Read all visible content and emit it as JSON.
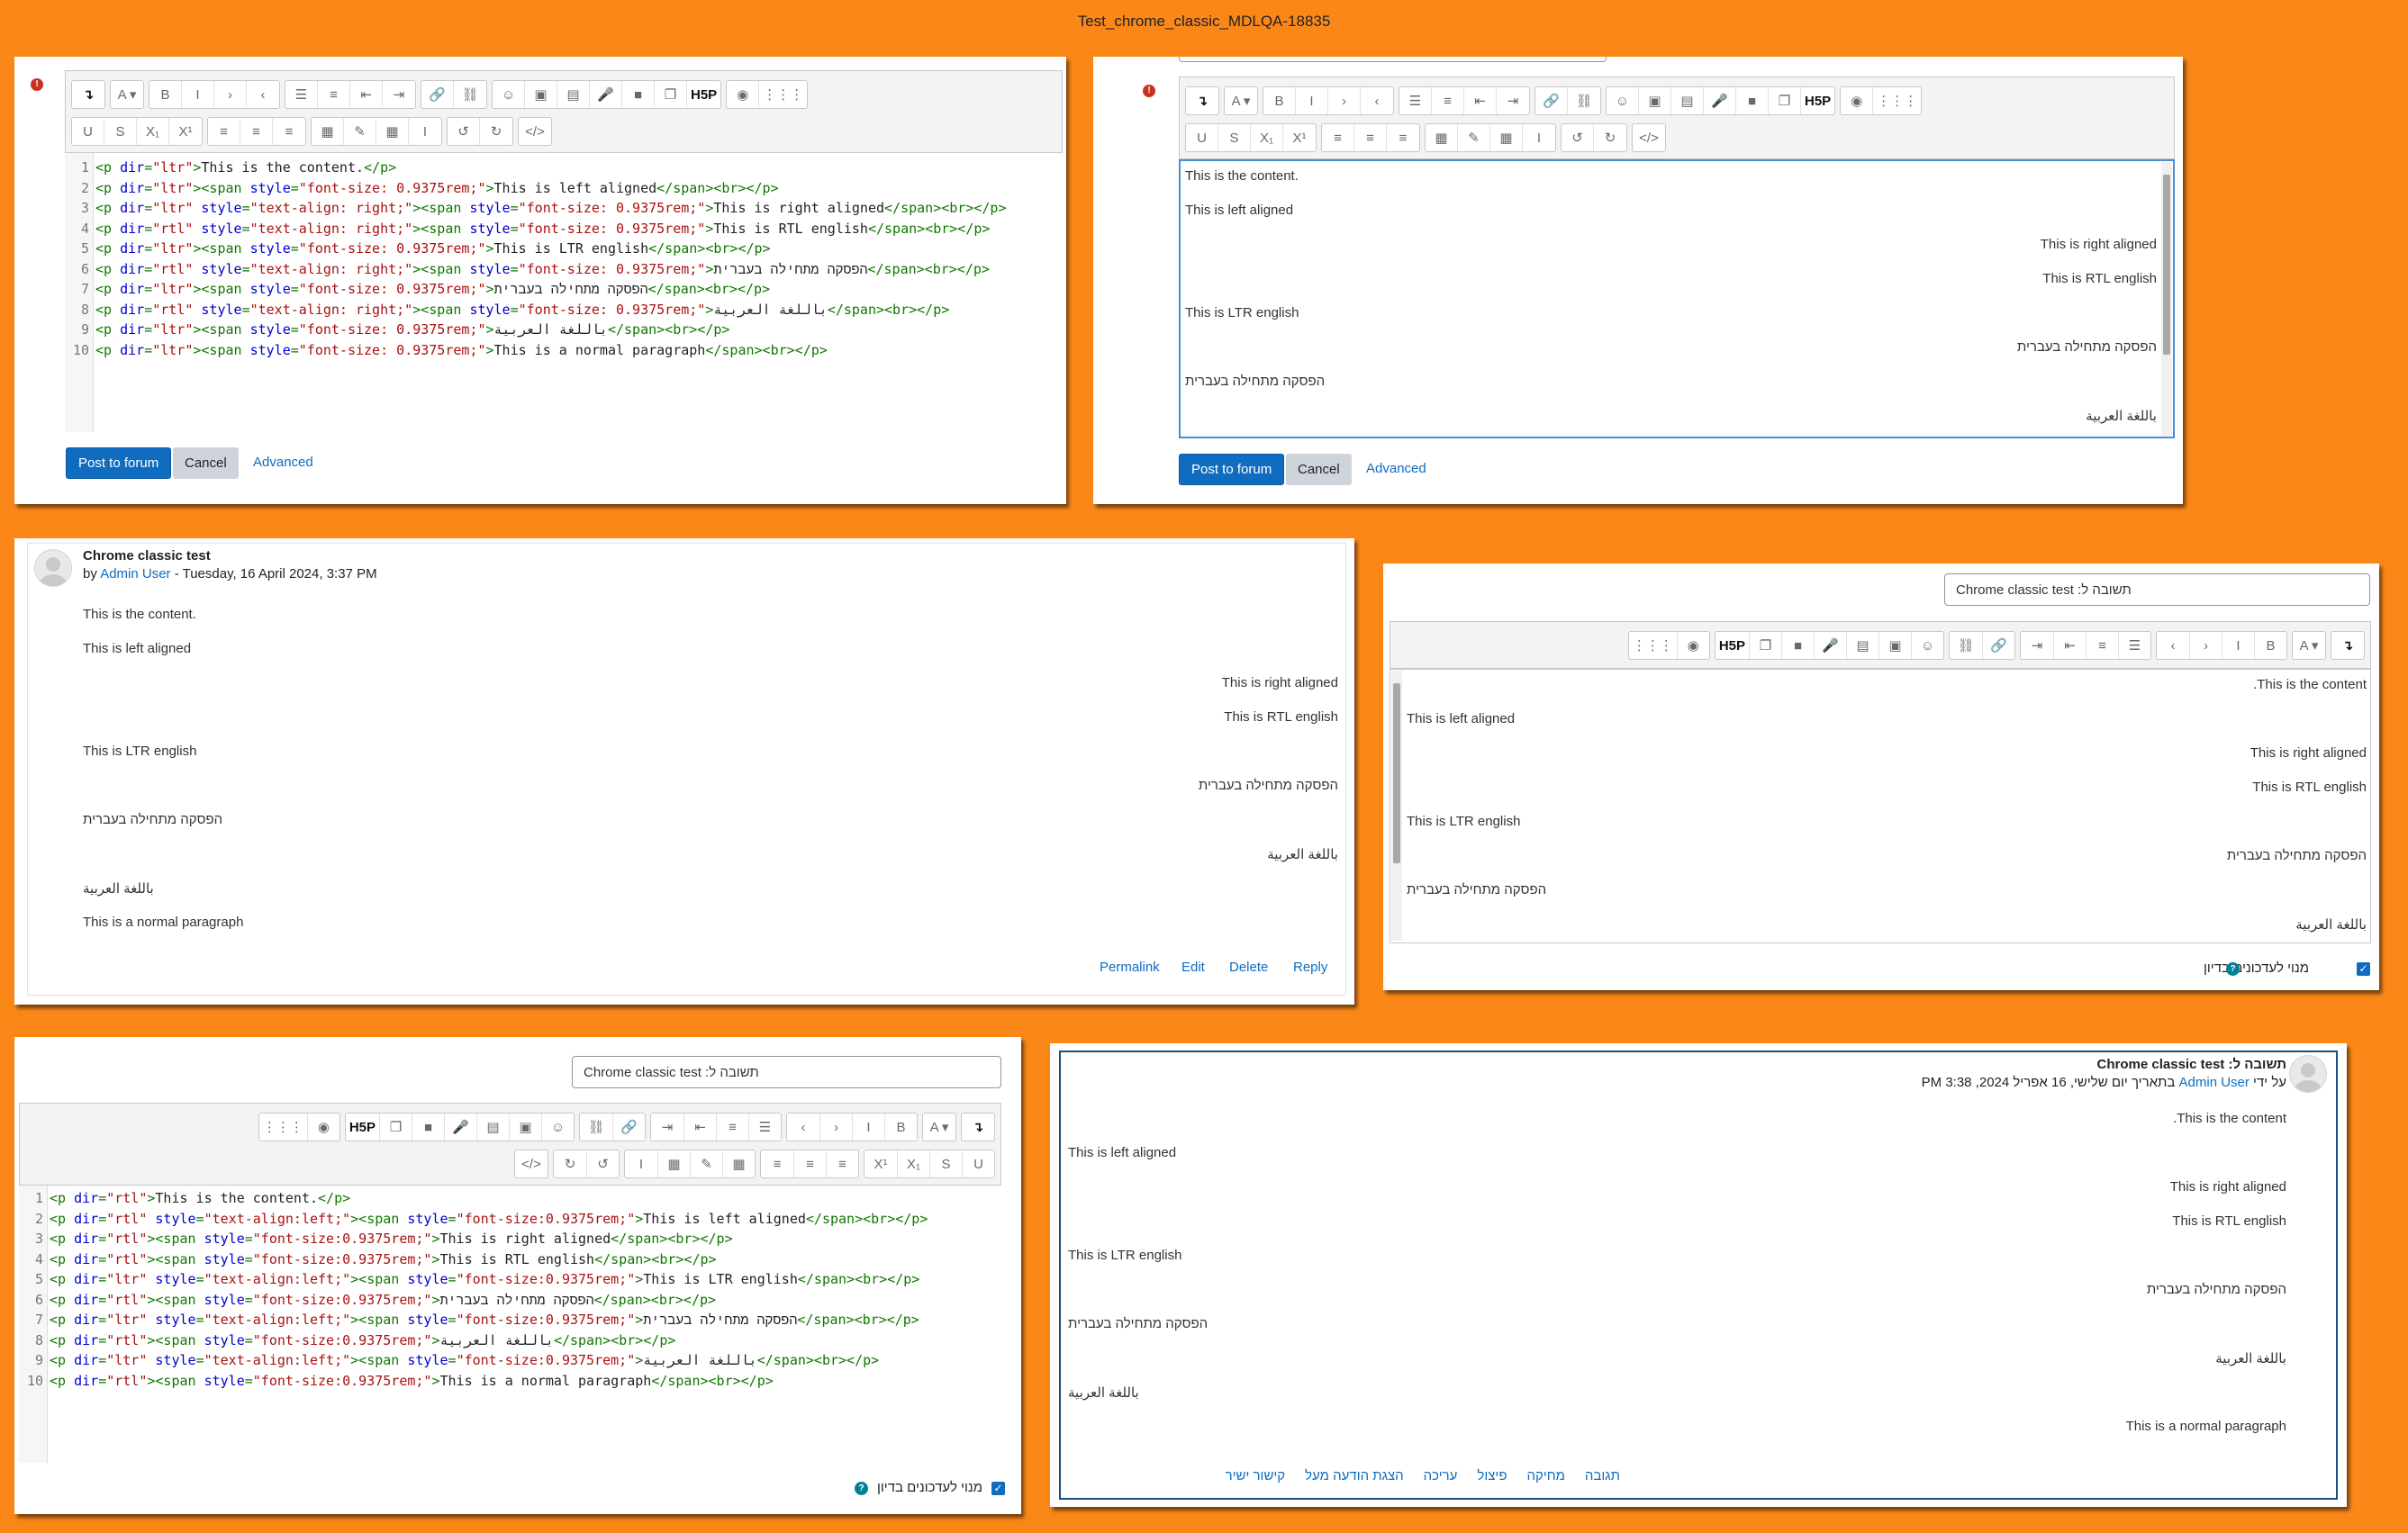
{
  "window_title": "Test_chrome_classic_MDLQA-18835",
  "code_lines": [
    [
      [
        "t",
        "<p "
      ],
      [
        "a",
        "dir"
      ],
      [
        "t",
        "="
      ],
      [
        "s",
        "\"ltr\""
      ],
      [
        "t",
        ">"
      ],
      [
        "x",
        "This is the content."
      ],
      [
        "t",
        "</p>"
      ]
    ],
    [
      [
        "t",
        "<p "
      ],
      [
        "a",
        "dir"
      ],
      [
        "t",
        "="
      ],
      [
        "s",
        "\"ltr\""
      ],
      [
        "t",
        "><span "
      ],
      [
        "a",
        "style"
      ],
      [
        "t",
        "="
      ],
      [
        "s",
        "\"font-size: 0.9375rem;\""
      ],
      [
        "t",
        ">"
      ],
      [
        "x",
        "This is left aligned"
      ],
      [
        "t",
        "</span><br></p>"
      ]
    ],
    [
      [
        "t",
        "<p "
      ],
      [
        "a",
        "dir"
      ],
      [
        "t",
        "="
      ],
      [
        "s",
        "\"ltr\" "
      ],
      [
        "a",
        "style"
      ],
      [
        "t",
        "="
      ],
      [
        "s",
        "\"text-align: right;\""
      ],
      [
        "t",
        "><span "
      ],
      [
        "a",
        "style"
      ],
      [
        "t",
        "="
      ],
      [
        "s",
        "\"font-size: 0.9375rem;\""
      ],
      [
        "t",
        ">"
      ],
      [
        "x",
        "This is right aligned"
      ],
      [
        "t",
        "</span><br></p>"
      ]
    ],
    [
      [
        "t",
        "<p "
      ],
      [
        "a",
        "dir"
      ],
      [
        "t",
        "="
      ],
      [
        "s",
        "\"rtl\" "
      ],
      [
        "a",
        "style"
      ],
      [
        "t",
        "="
      ],
      [
        "s",
        "\"text-align: right;\""
      ],
      [
        "t",
        "><span "
      ],
      [
        "a",
        "style"
      ],
      [
        "t",
        "="
      ],
      [
        "s",
        "\"font-size: 0.9375rem;\""
      ],
      [
        "t",
        ">"
      ],
      [
        "x",
        "This is RTL english"
      ],
      [
        "t",
        "</span><br></p>"
      ]
    ],
    [
      [
        "t",
        "<p "
      ],
      [
        "a",
        "dir"
      ],
      [
        "t",
        "="
      ],
      [
        "s",
        "\"ltr\""
      ],
      [
        "t",
        "><span "
      ],
      [
        "a",
        "style"
      ],
      [
        "t",
        "="
      ],
      [
        "s",
        "\"font-size: 0.9375rem;\""
      ],
      [
        "t",
        ">"
      ],
      [
        "x",
        "This is LTR english"
      ],
      [
        "t",
        "</span><br></p>"
      ]
    ],
    [
      [
        "t",
        "<p "
      ],
      [
        "a",
        "dir"
      ],
      [
        "t",
        "="
      ],
      [
        "s",
        "\"rtl\" "
      ],
      [
        "a",
        "style"
      ],
      [
        "t",
        "="
      ],
      [
        "s",
        "\"text-align: right;\""
      ],
      [
        "t",
        "><span "
      ],
      [
        "a",
        "style"
      ],
      [
        "t",
        "="
      ],
      [
        "s",
        "\"font-size: 0.9375rem;\""
      ],
      [
        "t",
        ">"
      ],
      [
        "x",
        "הפסקה מתחילה בעברית"
      ],
      [
        "t",
        "</span><br></p>"
      ]
    ],
    [
      [
        "t",
        "<p "
      ],
      [
        "a",
        "dir"
      ],
      [
        "t",
        "="
      ],
      [
        "s",
        "\"ltr\""
      ],
      [
        "t",
        "><span "
      ],
      [
        "a",
        "style"
      ],
      [
        "t",
        "="
      ],
      [
        "s",
        "\"font-size: 0.9375rem;\""
      ],
      [
        "t",
        ">"
      ],
      [
        "x",
        "הפסקה מתחילה בעברית"
      ],
      [
        "t",
        "</span><br></p>"
      ]
    ],
    [
      [
        "t",
        "<p "
      ],
      [
        "a",
        "dir"
      ],
      [
        "t",
        "="
      ],
      [
        "s",
        "\"rtl\" "
      ],
      [
        "a",
        "style"
      ],
      [
        "t",
        "="
      ],
      [
        "s",
        "\"text-align: right;\""
      ],
      [
        "t",
        "><span "
      ],
      [
        "a",
        "style"
      ],
      [
        "t",
        "="
      ],
      [
        "s",
        "\"font-size: 0.9375rem;\""
      ],
      [
        "t",
        ">"
      ],
      [
        "x",
        "باللغة العربية"
      ],
      [
        "t",
        "</span><br></p>"
      ]
    ],
    [
      [
        "t",
        "<p "
      ],
      [
        "a",
        "dir"
      ],
      [
        "t",
        "="
      ],
      [
        "s",
        "\"ltr\""
      ],
      [
        "t",
        "><span "
      ],
      [
        "a",
        "style"
      ],
      [
        "t",
        "="
      ],
      [
        "s",
        "\"font-size: 0.9375rem;\""
      ],
      [
        "t",
        ">"
      ],
      [
        "x",
        "باللغة العربية"
      ],
      [
        "t",
        "</span><br></p>"
      ]
    ],
    [
      [
        "t",
        "<p "
      ],
      [
        "a",
        "dir"
      ],
      [
        "t",
        "="
      ],
      [
        "s",
        "\"ltr\""
      ],
      [
        "t",
        "><span "
      ],
      [
        "a",
        "style"
      ],
      [
        "t",
        "="
      ],
      [
        "s",
        "\"font-size: 0.9375rem;\""
      ],
      [
        "t",
        ">"
      ],
      [
        "x",
        "This is a normal paragraph"
      ],
      [
        "t",
        "</span><br></p>"
      ]
    ]
  ],
  "code_lines_rtl": [
    [
      [
        "t",
        "<p "
      ],
      [
        "a",
        "dir"
      ],
      [
        "t",
        "="
      ],
      [
        "s",
        "\"rtl\""
      ],
      [
        "t",
        ">"
      ],
      [
        "x",
        "This is the content."
      ],
      [
        "t",
        "</p>"
      ]
    ],
    [
      [
        "t",
        "<p "
      ],
      [
        "a",
        "dir"
      ],
      [
        "t",
        "="
      ],
      [
        "s",
        "\"rtl\" "
      ],
      [
        "a",
        "style"
      ],
      [
        "t",
        "="
      ],
      [
        "s",
        "\"text-align:left;\""
      ],
      [
        "t",
        "><span "
      ],
      [
        "a",
        "style"
      ],
      [
        "t",
        "="
      ],
      [
        "s",
        "\"font-size:0.9375rem;\""
      ],
      [
        "t",
        ">"
      ],
      [
        "x",
        "This is left aligned"
      ],
      [
        "t",
        "</span><br></p>"
      ]
    ],
    [
      [
        "t",
        "<p "
      ],
      [
        "a",
        "dir"
      ],
      [
        "t",
        "="
      ],
      [
        "s",
        "\"rtl\""
      ],
      [
        "t",
        "><span "
      ],
      [
        "a",
        "style"
      ],
      [
        "t",
        "="
      ],
      [
        "s",
        "\"font-size:0.9375rem;\""
      ],
      [
        "t",
        ">"
      ],
      [
        "x",
        "This is right aligned"
      ],
      [
        "t",
        "</span><br></p>"
      ]
    ],
    [
      [
        "t",
        "<p "
      ],
      [
        "a",
        "dir"
      ],
      [
        "t",
        "="
      ],
      [
        "s",
        "\"rtl\""
      ],
      [
        "t",
        "><span "
      ],
      [
        "a",
        "style"
      ],
      [
        "t",
        "="
      ],
      [
        "s",
        "\"font-size:0.9375rem;\""
      ],
      [
        "t",
        ">"
      ],
      [
        "x",
        "This is RTL english"
      ],
      [
        "t",
        "</span><br></p>"
      ]
    ],
    [
      [
        "t",
        "<p "
      ],
      [
        "a",
        "dir"
      ],
      [
        "t",
        "="
      ],
      [
        "s",
        "\"ltr\" "
      ],
      [
        "a",
        "style"
      ],
      [
        "t",
        "="
      ],
      [
        "s",
        "\"text-align:left;\""
      ],
      [
        "t",
        "><span "
      ],
      [
        "a",
        "style"
      ],
      [
        "t",
        "="
      ],
      [
        "s",
        "\"font-size:0.9375rem;\""
      ],
      [
        "t",
        ">"
      ],
      [
        "x",
        "This is LTR english"
      ],
      [
        "t",
        "</span><br></p>"
      ]
    ],
    [
      [
        "t",
        "<p "
      ],
      [
        "a",
        "dir"
      ],
      [
        "t",
        "="
      ],
      [
        "s",
        "\"rtl\""
      ],
      [
        "t",
        "><span "
      ],
      [
        "a",
        "style"
      ],
      [
        "t",
        "="
      ],
      [
        "s",
        "\"font-size:0.9375rem;\""
      ],
      [
        "t",
        ">"
      ],
      [
        "x",
        "הפסקה מתחילה בעברית"
      ],
      [
        "t",
        "</span><br></p>"
      ]
    ],
    [
      [
        "t",
        "<p "
      ],
      [
        "a",
        "dir"
      ],
      [
        "t",
        "="
      ],
      [
        "s",
        "\"ltr\" "
      ],
      [
        "a",
        "style"
      ],
      [
        "t",
        "="
      ],
      [
        "s",
        "\"text-align:left;\""
      ],
      [
        "t",
        "><span "
      ],
      [
        "a",
        "style"
      ],
      [
        "t",
        "="
      ],
      [
        "s",
        "\"font-size:0.9375rem;\""
      ],
      [
        "t",
        ">"
      ],
      [
        "x",
        "הפסקה מתחילה בעברית"
      ],
      [
        "t",
        "</span><br></p>"
      ]
    ],
    [
      [
        "t",
        "<p "
      ],
      [
        "a",
        "dir"
      ],
      [
        "t",
        "="
      ],
      [
        "s",
        "\"rtl\""
      ],
      [
        "t",
        "><span "
      ],
      [
        "a",
        "style"
      ],
      [
        "t",
        "="
      ],
      [
        "s",
        "\"font-size:0.9375rem;\""
      ],
      [
        "t",
        ">"
      ],
      [
        "x",
        "باللغة العربية"
      ],
      [
        "t",
        "</span><br></p>"
      ]
    ],
    [
      [
        "t",
        "<p "
      ],
      [
        "a",
        "dir"
      ],
      [
        "t",
        "="
      ],
      [
        "s",
        "\"ltr\" "
      ],
      [
        "a",
        "style"
      ],
      [
        "t",
        "="
      ],
      [
        "s",
        "\"text-align:left;\""
      ],
      [
        "t",
        "><span "
      ],
      [
        "a",
        "style"
      ],
      [
        "t",
        "="
      ],
      [
        "s",
        "\"font-size:0.9375rem;\""
      ],
      [
        "t",
        ">"
      ],
      [
        "x",
        "باللغة العربية"
      ],
      [
        "t",
        "</span><br></p>"
      ]
    ],
    [
      [
        "t",
        "<p "
      ],
      [
        "a",
        "dir"
      ],
      [
        "t",
        "="
      ],
      [
        "s",
        "\"rtl\""
      ],
      [
        "t",
        "><span "
      ],
      [
        "a",
        "style"
      ],
      [
        "t",
        "="
      ],
      [
        "s",
        "\"font-size:0.9375rem;\""
      ],
      [
        "t",
        ">"
      ],
      [
        "x",
        "This is a normal paragraph"
      ],
      [
        "t",
        "</span><br></p>"
      ]
    ]
  ],
  "paragraphs": {
    "content": "This is the content.",
    "left": "This is left aligned",
    "right": "This is right aligned",
    "rtl_en": "This is RTL english",
    "ltr_en": "This is LTR english",
    "hebrew": "הפסקה מתחילה בעברית",
    "arabic": "باللغة العربية",
    "normal": "This is a normal paragraph",
    "content_rtl": ".This is the content"
  },
  "buttons": {
    "post": "Post to forum",
    "cancel": "Cancel",
    "advanced": "Advanced"
  },
  "post_ltr": {
    "subject": "Chrome classic test",
    "by": "by",
    "author": "Admin User",
    "date": " - Tuesday, 16 April 2024, 3:37 PM",
    "actions": [
      "Permalink",
      "Edit",
      "Delete",
      "Reply"
    ]
  },
  "reply_rtl": {
    "subject_value": "תשובה ל: Chrome classic test",
    "subscribe_label": "מנוי לעדכונים בדיון"
  },
  "post_rtl": {
    "subject": "תשובה ל: Chrome classic test",
    "by": "על ידי",
    "author": "Admin User",
    "date": "בתאריך יום שלישי, 16 אפריל 2024, 3:38 PM",
    "actions": [
      "קישור ישיר",
      "הצגת הודעה מעל",
      "עריכה",
      "פיצול",
      "מחיקה",
      "תגובה"
    ]
  },
  "toolbar_row1": [
    [
      "undo-arrow-icon",
      "↴"
    ],
    [
      "font-color-icon",
      "A ▾"
    ],
    [
      "bold-icon",
      "B"
    ],
    [
      "italic-icon",
      "I"
    ],
    [
      "indent-arrow-icon",
      "›"
    ],
    [
      "outdent-arrow-icon",
      "‹"
    ],
    [
      "bullet-list-icon",
      "☰"
    ],
    [
      "numbered-list-icon",
      "≡"
    ],
    [
      "outdent-icon",
      "⇤"
    ],
    [
      "indent-icon",
      "⇥"
    ],
    [
      "link-icon",
      "🔗"
    ],
    [
      "unlink-icon",
      "⛓"
    ],
    [
      "emoji-icon",
      "☺"
    ],
    [
      "image-icon",
      "▣"
    ],
    [
      "media-file-icon",
      "▤"
    ],
    [
      "microphone-icon",
      "🎤"
    ],
    [
      "video-icon",
      "■"
    ],
    [
      "copy-icon",
      "❐"
    ],
    [
      "h5p-icon",
      "H5P"
    ],
    [
      "accessibility-icon",
      "◉"
    ],
    [
      "grid-icon",
      "⋮⋮⋮"
    ]
  ],
  "toolbar_row2": [
    [
      "underline-icon",
      "U"
    ],
    [
      "strikethrough-icon",
      "S"
    ],
    [
      "subscript-icon",
      "X₁"
    ],
    [
      "superscript-icon",
      "X¹"
    ],
    [
      "align-left-icon",
      "≡"
    ],
    [
      "align-center-icon",
      "≡"
    ],
    [
      "align-right-icon",
      "≡"
    ],
    [
      "calculator-icon",
      "▦"
    ],
    [
      "edit-icon",
      "✎"
    ],
    [
      "table-icon",
      "▦"
    ],
    [
      "cursor-icon",
      "I"
    ],
    [
      "undo-icon",
      "↺"
    ],
    [
      "redo-icon",
      "↻"
    ],
    [
      "html-code-icon",
      "</>"
    ]
  ],
  "colors": {
    "background": "#fb8719",
    "primary": "#0f6cbf",
    "link": "#0f6cbf",
    "error": "#ca3120"
  }
}
